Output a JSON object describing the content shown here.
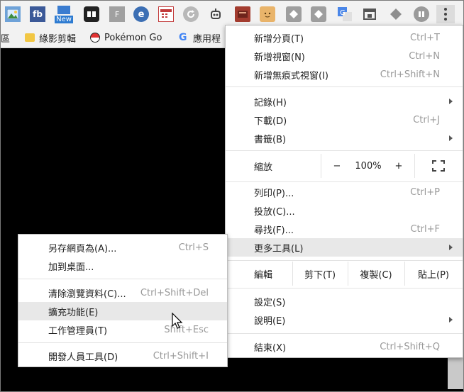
{
  "toolbar": {
    "extensions": [
      {
        "name": "photo-extension-icon",
        "text": "",
        "color": "#6ea2d8"
      },
      {
        "name": "fb-extension-icon",
        "text": "fb",
        "color": "#3b5998"
      },
      {
        "name": "new-extension-icon",
        "text": "New",
        "color": "#2d7bd1"
      },
      {
        "name": "dots-extension-icon",
        "text": "",
        "color": "#222222"
      },
      {
        "name": "f-extension-icon",
        "text": "F",
        "color": "#a0a0a0"
      },
      {
        "name": "e-extension-icon",
        "text": "e",
        "color": "#3c6fb4"
      },
      {
        "name": "calendar-extension-icon",
        "text": "",
        "color": "#c23b3b"
      },
      {
        "name": "refresh-extension-icon",
        "text": "",
        "color": "#b8b8b8"
      },
      {
        "name": "robot-extension-icon",
        "text": "",
        "color": "#444444"
      },
      {
        "name": "redbook-extension-icon",
        "text": "",
        "color": "#a33c2f"
      },
      {
        "name": "face-extension-icon",
        "text": "",
        "color": "#e9b46a"
      },
      {
        "name": "diamond-extension-icon",
        "text": "",
        "color": "#9e9e9e"
      },
      {
        "name": "diamond2-extension-icon",
        "text": "",
        "color": "#9e9e9e"
      },
      {
        "name": "translate-extension-icon",
        "text": "",
        "color": "#4a86e8"
      },
      {
        "name": "window-extension-icon",
        "text": "",
        "color": "#6b6b6b"
      },
      {
        "name": "layers-extension-icon",
        "text": "",
        "color": "#8e8e8e"
      },
      {
        "name": "pause-extension-icon",
        "text": "",
        "color": "#9a9a9a"
      }
    ],
    "new_badge": "New"
  },
  "bookmarks": {
    "items": [
      {
        "label": "區"
      },
      {
        "label": "綠影剪輯"
      },
      {
        "label": "Pokémon Go"
      },
      {
        "label": "應用程"
      }
    ]
  },
  "main_menu": {
    "new_tab": {
      "label": "新增分頁(T)",
      "shortcut": "Ctrl+T"
    },
    "new_window": {
      "label": "新增視窗(N)",
      "shortcut": "Ctrl+N"
    },
    "new_incognito": {
      "label": "新增無痕式視窗(I)",
      "shortcut": "Ctrl+Shift+N"
    },
    "history": {
      "label": "記錄(H)"
    },
    "downloads": {
      "label": "下載(D)",
      "shortcut": "Ctrl+J"
    },
    "bookmarks": {
      "label": "書籤(B)"
    },
    "zoom": {
      "label": "縮放",
      "minus": "−",
      "value": "100%",
      "plus": "+"
    },
    "print": {
      "label": "列印(P)...",
      "shortcut": "Ctrl+P"
    },
    "cast": {
      "label": "投放(C)..."
    },
    "find": {
      "label": "尋找(F)...",
      "shortcut": "Ctrl+F"
    },
    "more_tools": {
      "label": "更多工具(L)"
    },
    "edit": {
      "label": "編輯",
      "cut": "剪下(T)",
      "copy": "複製(C)",
      "paste": "貼上(P)"
    },
    "settings": {
      "label": "設定(S)"
    },
    "help": {
      "label": "說明(E)"
    },
    "exit": {
      "label": "結束(X)",
      "shortcut": "Ctrl+Shift+Q"
    }
  },
  "sub_menu": {
    "save_page": {
      "label": "另存網頁為(A)...",
      "shortcut": "Ctrl+S"
    },
    "add_desktop": {
      "label": "加到桌面..."
    },
    "clear_data": {
      "label": "清除瀏覽資料(C)...",
      "shortcut": "Ctrl+Shift+Del"
    },
    "extensions": {
      "label": "擴充功能(E)"
    },
    "task_manager": {
      "label": "工作管理員(T)",
      "shortcut": "Shift+Esc"
    },
    "dev_tools": {
      "label": "開發人員工具(D)",
      "shortcut": "Ctrl+Shift+I"
    }
  }
}
